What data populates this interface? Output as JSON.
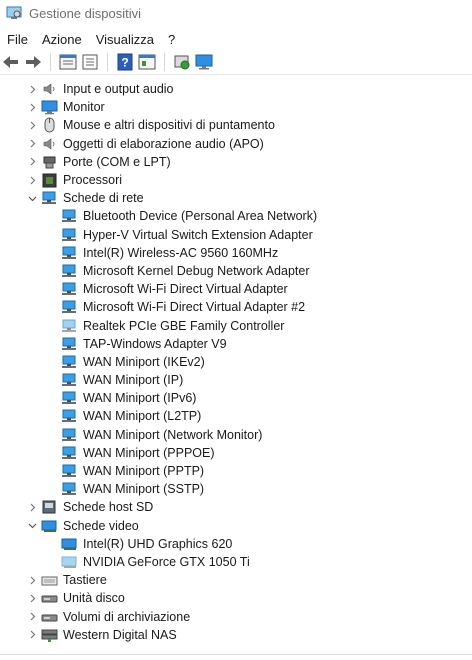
{
  "window": {
    "title": "Gestione dispositivi"
  },
  "menu": [
    "File",
    "Azione",
    "Visualizza",
    "?"
  ],
  "toolbar": [
    {
      "name": "back-arrow-icon"
    },
    {
      "name": "forward-arrow-icon"
    },
    {
      "sep": true
    },
    {
      "name": "properties-icon"
    },
    {
      "name": "list-view-icon"
    },
    {
      "sep": true
    },
    {
      "name": "help-icon"
    },
    {
      "name": "console-icon"
    },
    {
      "sep": true
    },
    {
      "name": "scan-hardware-icon"
    },
    {
      "name": "monitor-device-icon"
    }
  ],
  "tree": [
    {
      "label": "Input e output audio",
      "icon": "speaker",
      "expanded": false
    },
    {
      "label": "Monitor",
      "icon": "monitor",
      "expanded": false
    },
    {
      "label": "Mouse e altri dispositivi di puntamento",
      "icon": "mouse",
      "expanded": false
    },
    {
      "label": "Oggetti di elaborazione audio (APO)",
      "icon": "speaker",
      "expanded": false
    },
    {
      "label": "Porte (COM e LPT)",
      "icon": "port",
      "expanded": false
    },
    {
      "label": "Processori",
      "icon": "processor",
      "expanded": false
    },
    {
      "label": "Schede di rete",
      "icon": "network",
      "expanded": true,
      "children": [
        {
          "label": "Bluetooth Device (Personal Area Network)",
          "icon": "network"
        },
        {
          "label": "Hyper-V Virtual Switch Extension Adapter",
          "icon": "network"
        },
        {
          "label": "Intel(R) Wireless-AC 9560 160MHz",
          "icon": "network"
        },
        {
          "label": "Microsoft Kernel Debug Network Adapter",
          "icon": "network"
        },
        {
          "label": "Microsoft Wi-Fi Direct Virtual Adapter",
          "icon": "network"
        },
        {
          "label": "Microsoft Wi-Fi Direct Virtual Adapter #2",
          "icon": "network"
        },
        {
          "label": "Realtek PCIe GBE Family Controller",
          "icon": "network-faded"
        },
        {
          "label": "TAP-Windows Adapter V9",
          "icon": "network"
        },
        {
          "label": "WAN Miniport (IKEv2)",
          "icon": "network"
        },
        {
          "label": "WAN Miniport (IP)",
          "icon": "network"
        },
        {
          "label": "WAN Miniport (IPv6)",
          "icon": "network"
        },
        {
          "label": "WAN Miniport (L2TP)",
          "icon": "network"
        },
        {
          "label": "WAN Miniport (Network Monitor)",
          "icon": "network"
        },
        {
          "label": "WAN Miniport (PPPOE)",
          "icon": "network"
        },
        {
          "label": "WAN Miniport (PPTP)",
          "icon": "network"
        },
        {
          "label": "WAN Miniport (SSTP)",
          "icon": "network"
        }
      ]
    },
    {
      "label": "Schede host SD",
      "icon": "sd-host",
      "expanded": false
    },
    {
      "label": "Schede video",
      "icon": "display-adapter",
      "expanded": true,
      "children": [
        {
          "label": "Intel(R) UHD Graphics 620",
          "icon": "display-adapter"
        },
        {
          "label": "NVIDIA GeForce GTX 1050 Ti",
          "icon": "display-adapter-faded"
        }
      ]
    },
    {
      "label": "Tastiere",
      "icon": "keyboard",
      "expanded": false
    },
    {
      "label": "Unità disco",
      "icon": "disk",
      "expanded": false
    },
    {
      "label": "Volumi di archiviazione",
      "icon": "disk",
      "expanded": false
    },
    {
      "label": "Western Digital NAS",
      "icon": "nas",
      "expanded": false
    }
  ]
}
